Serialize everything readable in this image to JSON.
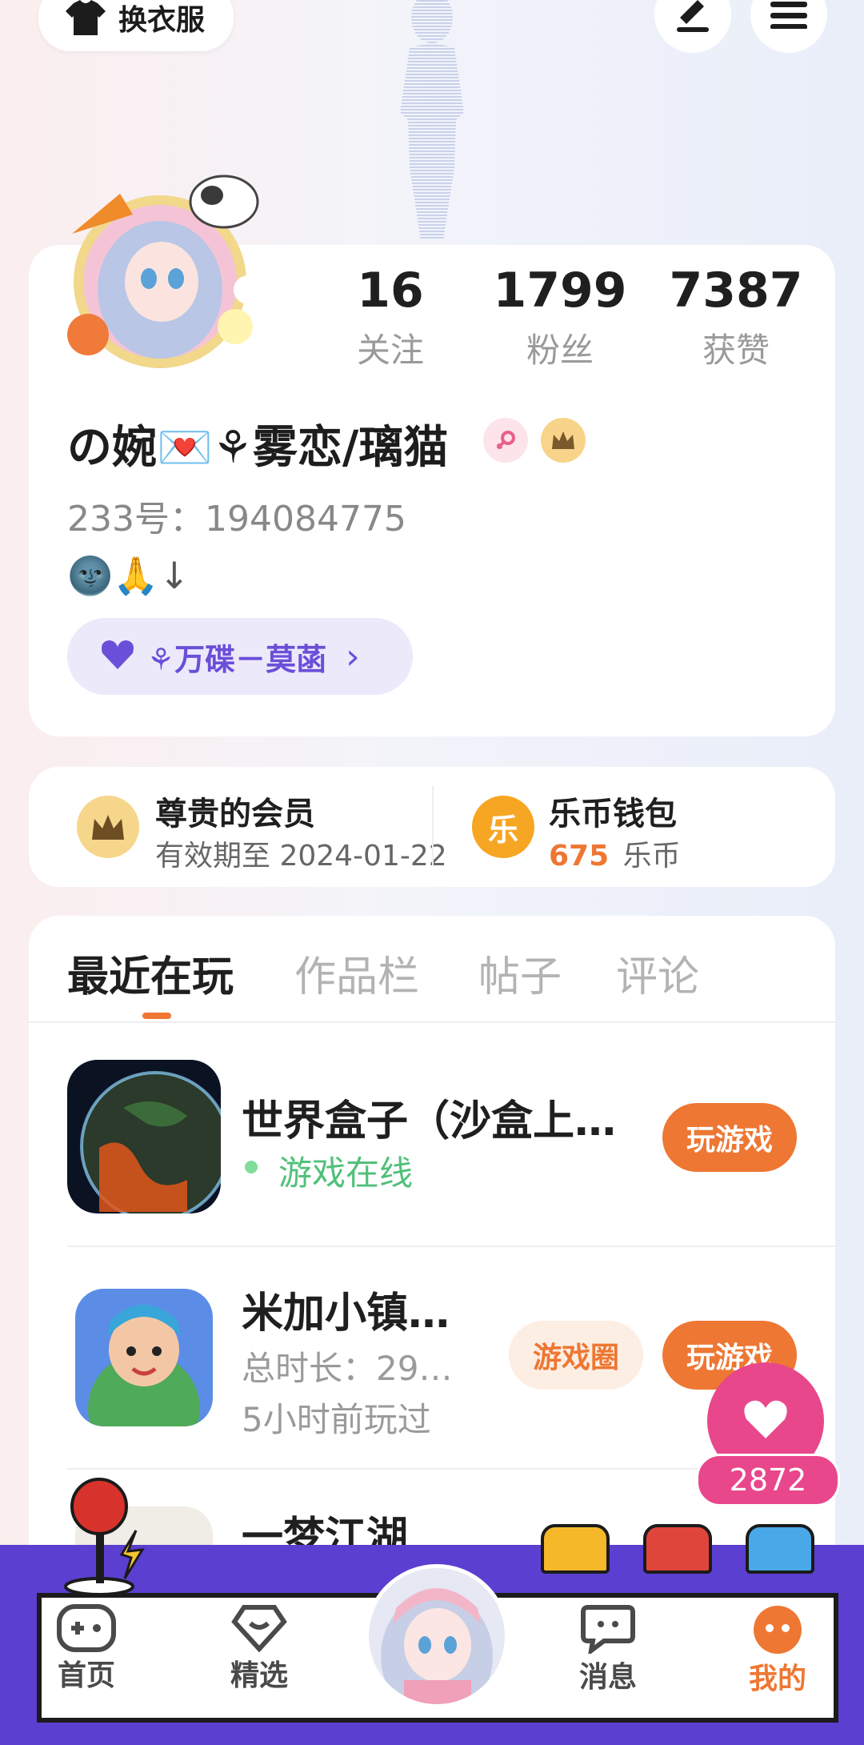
{
  "header": {
    "change_clothes_label": "换衣服",
    "edit_icon": "pencil-icon",
    "menu_icon": "hamburger-menu-icon"
  },
  "profile": {
    "stats": [
      {
        "value": "16",
        "label": "关注"
      },
      {
        "value": "1799",
        "label": "粉丝"
      },
      {
        "value": "7387",
        "label": "获赞"
      }
    ],
    "name": "の婉💌⚘雾恋/璃猫",
    "id_label": "233号：194084775",
    "bio": "🌚🙏↓",
    "tag_label": "⚘万碟－莫菡",
    "tag_arrow": "›"
  },
  "membership": {
    "title": "尊贵的会员",
    "expiry": "有效期至 2024-01-22"
  },
  "wallet": {
    "title": "乐币钱包",
    "icon_text": "乐",
    "amount": "675",
    "unit": "乐币"
  },
  "tabs": [
    {
      "label": "最近在玩",
      "active": true
    },
    {
      "label": "作品栏",
      "active": false
    },
    {
      "label": "帖子",
      "active": false
    },
    {
      "label": "评论",
      "active": false
    }
  ],
  "games": [
    {
      "title": "世界盒子（沙盒上…",
      "status": "游戏在线",
      "play_label": "玩游戏"
    },
    {
      "title": "米加小镇…",
      "duration": "总时长：29…",
      "last_played": "5小时前玩过",
      "circle_label": "游戏圈",
      "play_label": "玩游戏"
    },
    {
      "title": "一梦江湖"
    }
  ],
  "like_float": {
    "count": "2872"
  },
  "nav": [
    {
      "label": "首页",
      "icon": "gamepad-icon"
    },
    {
      "label": "精选",
      "icon": "heart-diamond-icon"
    },
    {
      "label": "消息",
      "icon": "chat-bubble-icon"
    },
    {
      "label": "我的",
      "icon": "profile-dots-icon",
      "active": true
    }
  ],
  "colors": {
    "accent": "#ee7733",
    "purple": "#5b3fd0",
    "online": "#52c07a",
    "like_pink": "#e8478b"
  }
}
